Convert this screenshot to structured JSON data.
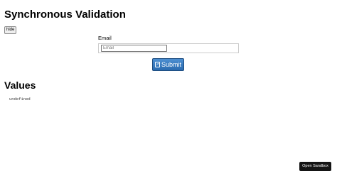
{
  "header": {
    "title": "Synchronous Validation"
  },
  "controls": {
    "hide_label": "hide"
  },
  "form": {
    "email_label": "Email",
    "email_value": "",
    "email_placeholder": "Email",
    "submit_label": "Submit"
  },
  "values": {
    "title": "Values",
    "content": "undefined"
  },
  "footer": {
    "sandbox_label": "Open Sandbox"
  },
  "colors": {
    "submit_background": "#337ab7",
    "sandbox_background": "#151515"
  },
  "icons": {
    "submit_icon": "paper-plane-icon"
  }
}
